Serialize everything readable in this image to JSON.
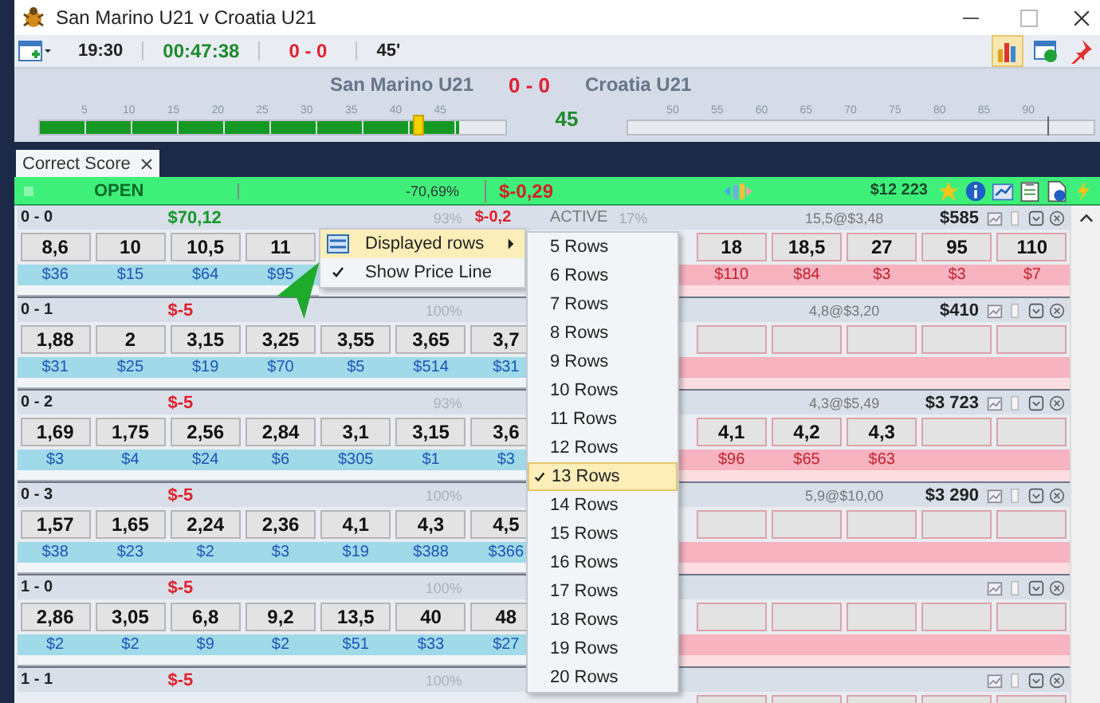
{
  "window": {
    "title": "San Marino U21 v Croatia U21"
  },
  "toolbar": {
    "start_time": "19:30",
    "elapsed": "00:47:38",
    "score": "0 - 0",
    "minute": "45'"
  },
  "scoreboard": {
    "home": "San Marino U21",
    "score": "0 - 0",
    "away": "Croatia U21",
    "minute": "45",
    "first_half": {
      "ticks": [
        "5",
        "10",
        "15",
        "20",
        "25",
        "30",
        "35",
        "40",
        "45"
      ],
      "level": 0.9
    },
    "second_half": {
      "ticks": [
        "50",
        "55",
        "60",
        "65",
        "70",
        "75",
        "80",
        "85",
        "90"
      ]
    }
  },
  "tabs": [
    {
      "label": "Correct Score",
      "selected": true
    }
  ],
  "status_bar": {
    "state": "OPEN",
    "percent": "-70,69%",
    "profit": "$-0,29",
    "balance": "$12 223"
  },
  "markets": [
    {
      "score": "0 - 0",
      "pnl": "$70,12",
      "pnl_positive": true,
      "percent": "93%",
      "lay_pnl": "$-0,2",
      "status": "ACTIVE",
      "status_percent": "17%",
      "bet": "15,5@$3,48",
      "amount": "$585",
      "back": [
        {
          "price": "8,6",
          "stake": "$36"
        },
        {
          "price": "10",
          "stake": "$15"
        },
        {
          "price": "10,5",
          "stake": "$64"
        },
        {
          "price": "11",
          "stake": "$95"
        }
      ],
      "lay": [
        {
          "price": "18",
          "stake": "$110"
        },
        {
          "price": "18,5",
          "stake": "$84"
        },
        {
          "price": "27",
          "stake": "$3"
        },
        {
          "price": "95",
          "stake": "$3"
        },
        {
          "price": "110",
          "stake": "$7"
        }
      ]
    },
    {
      "score": "0 - 1",
      "pnl": "$-5",
      "pnl_positive": false,
      "percent": "100%",
      "bet": "4,8@$3,20",
      "amount": "$410",
      "back": [
        {
          "price": "1,88",
          "stake": "$31"
        },
        {
          "price": "2",
          "stake": "$25"
        },
        {
          "price": "3,15",
          "stake": "$19"
        },
        {
          "price": "3,25",
          "stake": "$70"
        },
        {
          "price": "3,55",
          "stake": "$5"
        },
        {
          "price": "3,65",
          "stake": "$514"
        },
        {
          "price": "3,7",
          "stake": "$31"
        }
      ]
    },
    {
      "score": "0 - 2",
      "pnl": "$-5",
      "pnl_positive": false,
      "percent": "93%",
      "bet": "4,3@$5,49",
      "amount": "$3 723",
      "back": [
        {
          "price": "1,69",
          "stake": "$3"
        },
        {
          "price": "1,75",
          "stake": "$4"
        },
        {
          "price": "2,56",
          "stake": "$24"
        },
        {
          "price": "2,84",
          "stake": "$6"
        },
        {
          "price": "3,1",
          "stake": "$305"
        },
        {
          "price": "3,15",
          "stake": "$1"
        },
        {
          "price": "3,6",
          "stake": "$3"
        }
      ],
      "lay": [
        {
          "price": "4,1",
          "stake": "$96"
        },
        {
          "price": "4,2",
          "stake": "$65"
        },
        {
          "price": "4,3",
          "stake": "$63"
        }
      ]
    },
    {
      "score": "0 - 3",
      "pnl": "$-5",
      "pnl_positive": false,
      "percent": "100%",
      "bet": "5,9@$10,00",
      "amount": "$3 290",
      "back": [
        {
          "price": "1,57",
          "stake": "$38"
        },
        {
          "price": "1,65",
          "stake": "$23"
        },
        {
          "price": "2,24",
          "stake": "$2"
        },
        {
          "price": "2,36",
          "stake": "$3"
        },
        {
          "price": "4,1",
          "stake": "$19"
        },
        {
          "price": "4,3",
          "stake": "$388"
        },
        {
          "price": "4,5",
          "stake": "$366"
        }
      ]
    },
    {
      "score": "1 - 0",
      "pnl": "$-5",
      "pnl_positive": false,
      "percent": "100%",
      "back": [
        {
          "price": "2,86",
          "stake": "$2"
        },
        {
          "price": "3,05",
          "stake": "$2"
        },
        {
          "price": "6,8",
          "stake": "$9"
        },
        {
          "price": "9,2",
          "stake": "$2"
        },
        {
          "price": "13,5",
          "stake": "$51"
        },
        {
          "price": "40",
          "stake": "$33"
        },
        {
          "price": "48",
          "stake": "$27"
        }
      ]
    },
    {
      "score": "1 - 1",
      "pnl": "$-5",
      "pnl_positive": false,
      "percent": "100%"
    }
  ],
  "context_menu": {
    "items": [
      {
        "label": "Displayed rows",
        "kind": "submenu",
        "selected": true,
        "checked": false
      },
      {
        "label": "Show Price Line",
        "kind": "option",
        "selected": false,
        "checked": true
      }
    ]
  },
  "rows_submenu": {
    "items": [
      {
        "label": "5 Rows",
        "selected": false
      },
      {
        "label": "6 Rows",
        "selected": false
      },
      {
        "label": "7 Rows",
        "selected": false
      },
      {
        "label": "8 Rows",
        "selected": false
      },
      {
        "label": "9 Rows",
        "selected": false
      },
      {
        "label": "10 Rows",
        "selected": false
      },
      {
        "label": "11 Rows",
        "selected": false
      },
      {
        "label": "12 Rows",
        "selected": false
      },
      {
        "label": "13 Rows",
        "selected": true
      },
      {
        "label": "14 Rows",
        "selected": false
      },
      {
        "label": "15 Rows",
        "selected": false
      },
      {
        "label": "16 Rows",
        "selected": false
      },
      {
        "label": "17 Rows",
        "selected": false
      },
      {
        "label": "18 Rows",
        "selected": false
      },
      {
        "label": "19 Rows",
        "selected": false
      },
      {
        "label": "20 Rows",
        "selected": false
      }
    ]
  }
}
